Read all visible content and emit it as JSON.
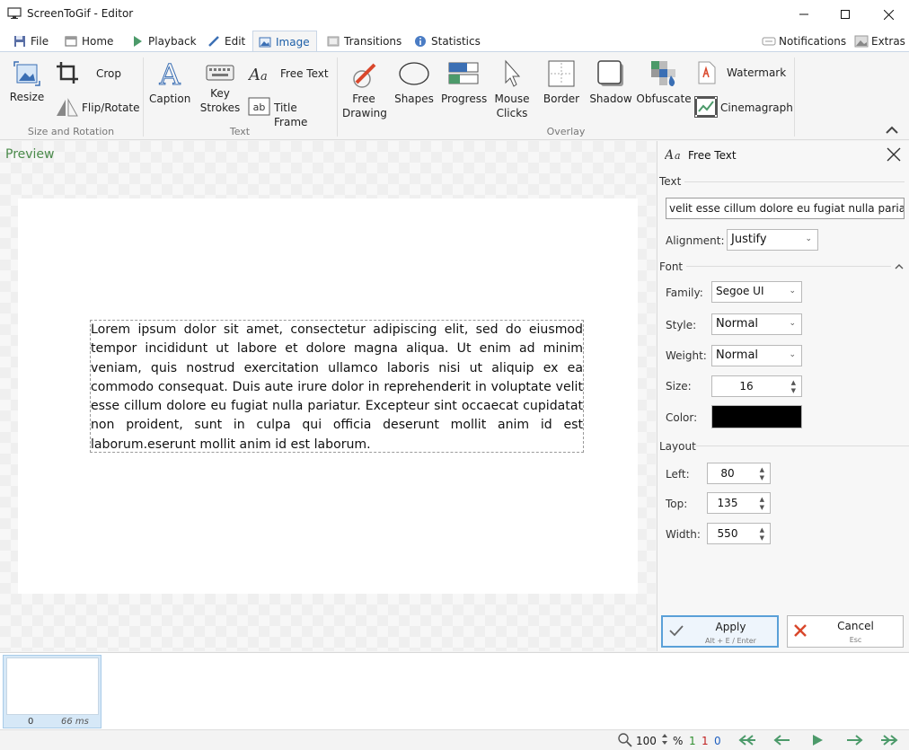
{
  "window": {
    "title": "ScreenToGif - Editor"
  },
  "tabs": [
    {
      "label": "File"
    },
    {
      "label": "Home"
    },
    {
      "label": "Playback"
    },
    {
      "label": "Edit"
    },
    {
      "label": "Image"
    },
    {
      "label": "Transitions"
    },
    {
      "label": "Statistics"
    }
  ],
  "header_right": {
    "notifications": "Notifications",
    "extras": "Extras"
  },
  "ribbon": {
    "resize": "Resize",
    "crop": "Crop",
    "flip_rotate": "Flip/Rotate",
    "group_size": "Size and Rotation",
    "caption": "Caption",
    "key_strokes_1": "Key",
    "key_strokes_2": "Strokes",
    "free_text": "Free Text",
    "title_frame": "Title Frame",
    "group_text": "Text",
    "free_drawing_1": "Free",
    "free_drawing_2": "Drawing",
    "shapes": "Shapes",
    "progress": "Progress",
    "mouse_clicks_1": "Mouse",
    "mouse_clicks_2": "Clicks",
    "border": "Border",
    "shadow": "Shadow",
    "obfuscate": "Obfuscate",
    "watermark": "Watermark",
    "cinemagraph": "Cinemagraph",
    "group_overlay": "Overlay"
  },
  "preview": {
    "label": "Preview",
    "text": "Lorem ipsum dolor sit amet, consectetur adipiscing elit, sed do eiusmod tempor incididunt ut labore et dolore magna aliqua. Ut enim ad minim veniam, quis nostrud exercitation ullamco laboris nisi ut aliquip ex ea commodo consequat. Duis aute irure dolor in reprehenderit in voluptate velit esse cillum dolore eu fugiat nulla pariatur. Excepteur sint occaecat cupidatat non proident, sunt in culpa qui officia deserunt mollit anim id est laborum.eserunt mollit anim id est laborum."
  },
  "panel": {
    "title": "Free Text",
    "section_text": "Text",
    "text_value": "velit esse cillum dolore eu fugiat nulla pariatur. Ex",
    "alignment_label": "Alignment:",
    "alignment_value": "Justify",
    "section_font": "Font",
    "family_label": "Family:",
    "family_value": "Segoe UI",
    "style_label": "Style:",
    "style_value": "Normal",
    "weight_label": "Weight:",
    "weight_value": "Normal",
    "size_label": "Size:",
    "size_value": "16",
    "color_label": "Color:",
    "color_value": "#000000",
    "section_layout": "Layout",
    "left_label": "Left:",
    "left_value": "80",
    "top_label": "Top:",
    "top_value": "135",
    "width_label": "Width:",
    "width_value": "550",
    "apply_label": "Apply",
    "apply_shortcut": "Alt + E / Enter",
    "cancel_label": "Cancel",
    "cancel_shortcut": "Esc"
  },
  "timeline": {
    "frame_index": "0",
    "frame_delay": "66 ms"
  },
  "statusbar": {
    "zoom": "100",
    "zoom_unit": "%",
    "count_a": "1",
    "count_b": "1",
    "count_c": "0"
  },
  "colors": {
    "accent": "#1d5fa8",
    "apply_border": "#5aa0d8",
    "cancel_x": "#d9472b",
    "preview_label": "#4a8a4a"
  }
}
